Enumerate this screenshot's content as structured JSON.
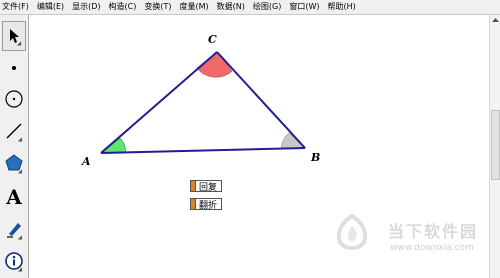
{
  "menubar": {
    "items": [
      "文件(F)",
      "编辑(E)",
      "显示(D)",
      "构造(C)",
      "变换(T)",
      "度量(M)",
      "数据(N)",
      "绘图(G)",
      "窗口(W)",
      "帮助(H)"
    ]
  },
  "toolbar": {
    "tools": [
      {
        "name": "arrow-select-tool-icon"
      },
      {
        "name": "point-tool-icon"
      },
      {
        "name": "compass-tool-icon"
      },
      {
        "name": "straightedge-tool-icon"
      },
      {
        "name": "polygon-tool-icon"
      },
      {
        "name": "text-tool-icon",
        "glyph": "A"
      },
      {
        "name": "marker-tool-icon"
      },
      {
        "name": "information-tool-icon"
      }
    ]
  },
  "canvas": {
    "vertices": {
      "A": "A",
      "B": "B",
      "C": "C"
    },
    "buttons": {
      "restore": "回复",
      "flip": "翻折"
    },
    "colors": {
      "triangle_sides": "#1f1f8f",
      "angle_A": "#5ce66b",
      "angle_B": "#c8c8c8",
      "angle_C": "#f06a6a",
      "button_swatch": "#d9862a"
    }
  },
  "watermark": {
    "name": "当下软件园",
    "url": "www.downxia.com"
  }
}
